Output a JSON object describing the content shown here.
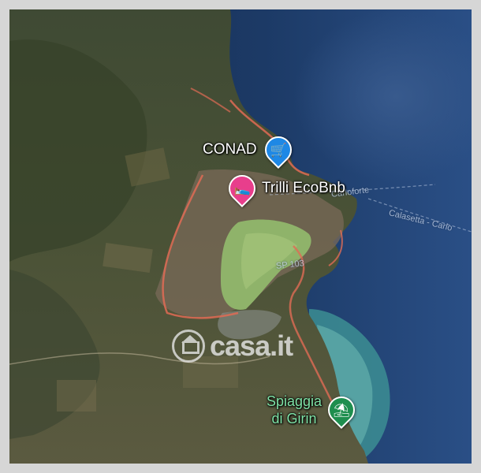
{
  "map": {
    "pins": [
      {
        "label": "CONAD",
        "icon": "shopping-cart-icon",
        "color": "#1e88e5"
      },
      {
        "label": "Trilli EcoBnb",
        "icon": "bed-icon",
        "color": "#e83e8c"
      },
      {
        "label_line1": "Spiaggia",
        "label_line2": "di Girin",
        "icon": "beach-umbrella-icon",
        "color": "#1e8e4e"
      }
    ],
    "road_labels": [
      "Carloforte",
      "Calasetta - Carlo",
      "SP 103"
    ],
    "watermark": "casa.it"
  }
}
